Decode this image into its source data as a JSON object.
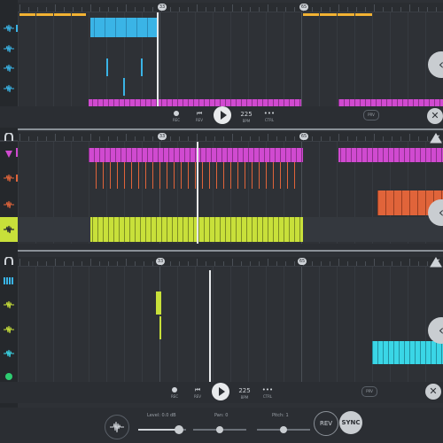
{
  "colors": {
    "cyan": "#3ab4e6",
    "magenta": "#d04ad0",
    "orange": "#e0643a",
    "lime": "#c8e03a",
    "yellow": "#f2b233",
    "teal": "#3ad6e6"
  },
  "panel1": {
    "markers": [
      "33",
      "65"
    ],
    "transport": {
      "rec_label": "REC",
      "rev_label": "REV",
      "bpm_value": "225",
      "bpm_label": "BPM",
      "ctrl_label": "CTRL",
      "prv_label": "PRV"
    }
  },
  "panel2": {
    "markers": [
      "33",
      "65"
    ]
  },
  "panel3": {
    "markers": [
      "33",
      "65"
    ],
    "transport": {
      "rec_label": "REC",
      "rev_label": "REV",
      "bpm_value": "225",
      "bpm_label": "BPM",
      "ctrl_label": "CTRL",
      "prv_label": "PRV"
    }
  },
  "bottom": {
    "level_label": "Level: 0.0 dB",
    "pan_label": "Pan: 0",
    "pitch_label": "Pitch: 1",
    "level_value": 0.85,
    "pan_value": 0.5,
    "pitch_value": 0.5,
    "rev_button": "REV",
    "sync_button": "SYNC"
  },
  "icons": [
    "waveform-icon",
    "mixer-icon",
    "magnet-icon",
    "chevron-left-icon",
    "close-icon",
    "dj-icon",
    "record-icon",
    "skip-back-icon",
    "play-icon",
    "dots-icon"
  ]
}
